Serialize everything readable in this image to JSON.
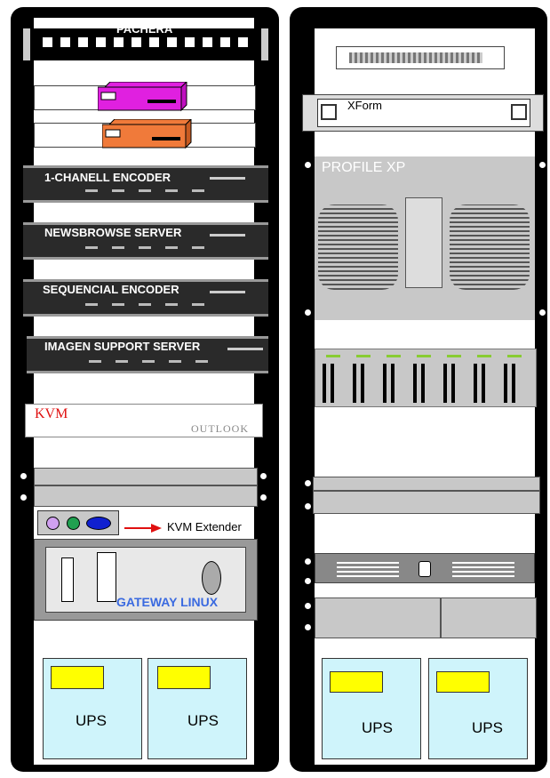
{
  "left_rack": {
    "patch_panel_label": "PACHERA",
    "encoder_label": "1-CHANELL ENCODER",
    "newsbrowse_label": "NEWSBROWSE SERVER",
    "sequencial_label": "SEQUENCIAL ENCODER",
    "imagen_label": "IMAGEN SUPPORT SERVER",
    "kvm_label": "KVM",
    "outlook_label": "OUTLOOK",
    "kvm_extender_label": "KVM Extender",
    "gateway_label": "GATEWAY LINUX",
    "ups_1_label": "UPS",
    "ups_2_label": "UPS"
  },
  "right_rack": {
    "xform_label": "XForm",
    "profile_label": "PROFILE XP",
    "ups_1_label": "UPS",
    "ups_2_label": "UPS"
  },
  "colors": {
    "magenta_device": "#e020e0",
    "orange_device": "#f07a3a",
    "ups_fill": "#cff4fb",
    "battery": "#ffff00",
    "gateway_text": "#3a6ae0",
    "kvm_text": "#e01010",
    "arrow": "#e01010"
  }
}
